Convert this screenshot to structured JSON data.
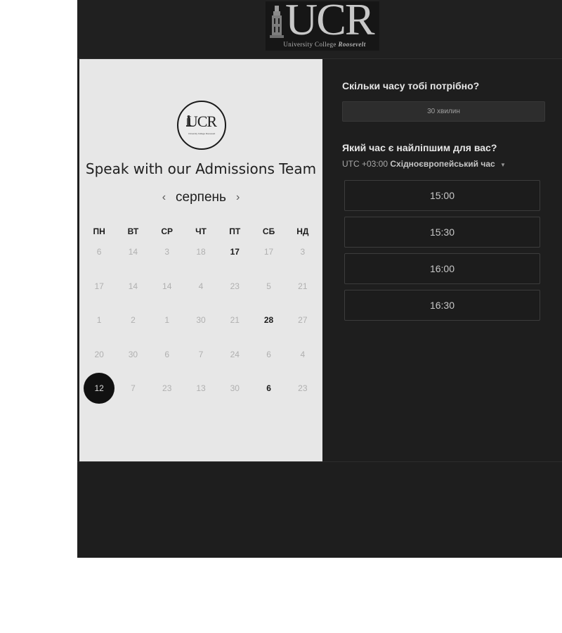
{
  "header": {
    "logo_text": "UCR",
    "logo_subtitle_plain": "University College",
    "logo_subtitle_italic": "Roosevelt"
  },
  "event": {
    "logo_text": "UCR",
    "title": "Speak with our Admissions Team"
  },
  "calendar": {
    "month": "серпень",
    "prev_symbol": "‹",
    "next_symbol": "›",
    "weekdays": [
      "ПН",
      "ВТ",
      "СР",
      "ЧТ",
      "ПТ",
      "СБ",
      "НД"
    ],
    "days": [
      {
        "label": "6",
        "state": "disabled"
      },
      {
        "label": "14",
        "state": "disabled"
      },
      {
        "label": "3",
        "state": "disabled"
      },
      {
        "label": "18",
        "state": "disabled"
      },
      {
        "label": "17",
        "state": "available"
      },
      {
        "label": "17",
        "state": "disabled"
      },
      {
        "label": "3",
        "state": "disabled"
      },
      {
        "label": "17",
        "state": "disabled"
      },
      {
        "label": "14",
        "state": "disabled"
      },
      {
        "label": "14",
        "state": "disabled"
      },
      {
        "label": "4",
        "state": "disabled"
      },
      {
        "label": "23",
        "state": "disabled"
      },
      {
        "label": "5",
        "state": "disabled"
      },
      {
        "label": "21",
        "state": "disabled"
      },
      {
        "label": "1",
        "state": "disabled"
      },
      {
        "label": "2",
        "state": "disabled"
      },
      {
        "label": "1",
        "state": "disabled"
      },
      {
        "label": "30",
        "state": "disabled"
      },
      {
        "label": "21",
        "state": "disabled"
      },
      {
        "label": "28",
        "state": "available"
      },
      {
        "label": "27",
        "state": "disabled"
      },
      {
        "label": "20",
        "state": "disabled"
      },
      {
        "label": "30",
        "state": "disabled"
      },
      {
        "label": "6",
        "state": "disabled"
      },
      {
        "label": "7",
        "state": "disabled"
      },
      {
        "label": "24",
        "state": "disabled"
      },
      {
        "label": "6",
        "state": "disabled"
      },
      {
        "label": "4",
        "state": "disabled"
      },
      {
        "label": "12",
        "state": "selected"
      },
      {
        "label": "7",
        "state": "disabled"
      },
      {
        "label": "23",
        "state": "disabled"
      },
      {
        "label": "13",
        "state": "disabled"
      },
      {
        "label": "30",
        "state": "disabled"
      },
      {
        "label": "6",
        "state": "available"
      },
      {
        "label": "23",
        "state": "disabled"
      }
    ]
  },
  "booking": {
    "duration_question": "Скільки часу тобі потрібно?",
    "duration_value": "30 хвилин",
    "time_question": "Який час є найліпшим для вас?",
    "timezone_offset": "UTC +03:00",
    "timezone_name": "Східноєвропейський час",
    "slots": [
      "15:00",
      "15:30",
      "16:00",
      "16:30"
    ]
  },
  "colors": {
    "dark_bg": "#1e1e1e",
    "calendar_bg": "#e7e7e7",
    "selected_day": "#111111"
  }
}
